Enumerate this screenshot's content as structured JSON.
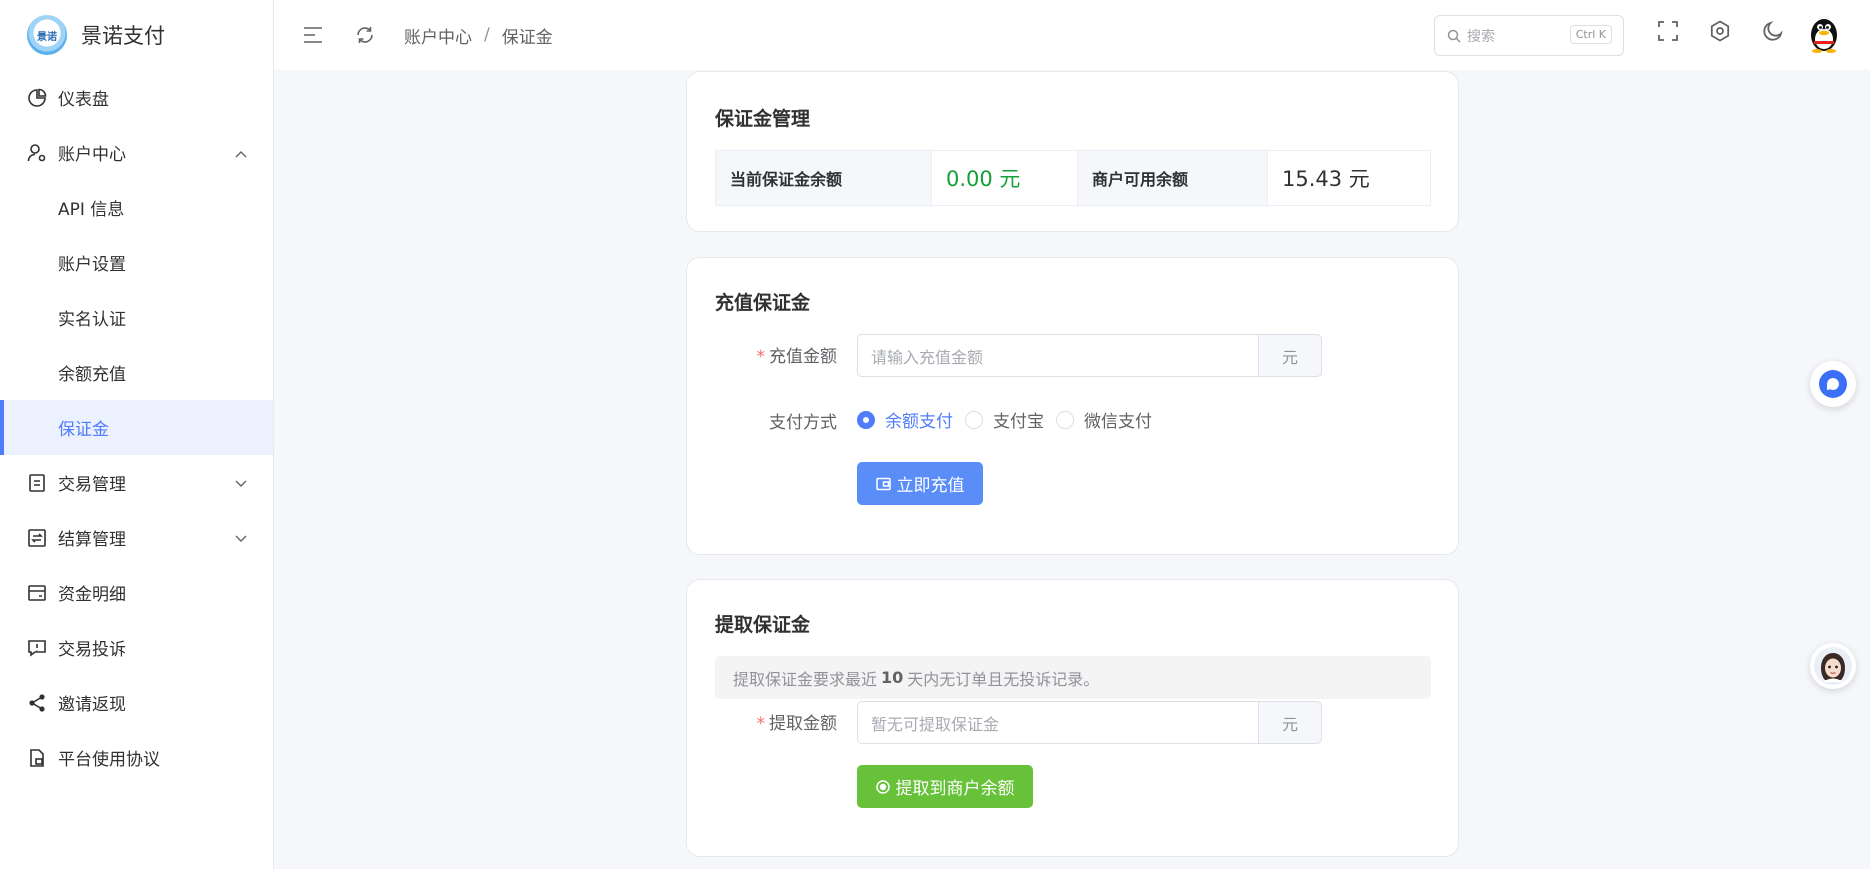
{
  "brand": {
    "name": "景诺支付",
    "logo_text": "景诺"
  },
  "sidebar": {
    "items": [
      {
        "label": "仪表盘",
        "icon": "pie-chart-icon"
      },
      {
        "label": "账户中心",
        "icon": "user-settings-icon",
        "expanded": true
      },
      {
        "label": "API 信息"
      },
      {
        "label": "账户设置"
      },
      {
        "label": "实名认证"
      },
      {
        "label": "余额充值"
      },
      {
        "label": "保证金",
        "active": true
      },
      {
        "label": "交易管理",
        "icon": "document-icon"
      },
      {
        "label": "结算管理",
        "icon": "exchange-icon"
      },
      {
        "label": "资金明细",
        "icon": "wallet-icon"
      },
      {
        "label": "交易投诉",
        "icon": "alert-message-icon"
      },
      {
        "label": "邀请返现",
        "icon": "share-icon"
      },
      {
        "label": "平台使用协议",
        "icon": "file-lock-icon"
      }
    ]
  },
  "header": {
    "breadcrumb": [
      "账户中心",
      "保证金"
    ],
    "search_placeholder": "搜索",
    "search_shortcut": "Ctrl K"
  },
  "deposit_mgmt": {
    "title": "保证金管理",
    "current_label": "当前保证金余额",
    "current_value": "0.00 元",
    "available_label": "商户可用余额",
    "available_value": "15.43 元"
  },
  "recharge": {
    "title": "充值保证金",
    "amount_label": "充值金额",
    "amount_placeholder": "请输入充值金额",
    "unit": "元",
    "method_label": "支付方式",
    "methods": [
      "余额支付",
      "支付宝",
      "微信支付"
    ],
    "selected_method": "余额支付",
    "submit_label": "立即充值"
  },
  "withdraw": {
    "title": "提取保证金",
    "notice_prefix": "提取保证金要求最近",
    "notice_days": "10",
    "notice_suffix": "天内无订单且无投诉记录。",
    "amount_label": "提取金额",
    "amount_placeholder": "暂无可提取保证金",
    "unit": "元",
    "submit_label": "提取到商户余额"
  },
  "colors": {
    "primary": "#4f7df9",
    "success": "#67c23a",
    "amount_green": "#13a038",
    "danger": "#f56c6c"
  }
}
